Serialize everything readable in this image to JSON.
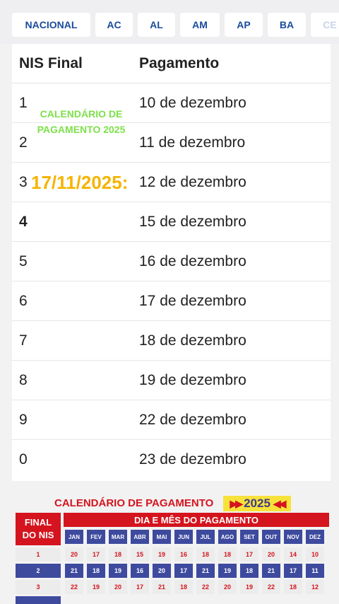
{
  "tabs": [
    "NACIONAL",
    "AC",
    "AL",
    "AM",
    "AP",
    "BA",
    "CE"
  ],
  "table": {
    "headers": {
      "nis": "NIS Final",
      "pagamento": "Pagamento"
    },
    "rows": [
      {
        "nis": "1",
        "pagamento": "10 de dezembro"
      },
      {
        "nis": "2",
        "pagamento": "11 de dezembro"
      },
      {
        "nis": "3",
        "pagamento": "12 de dezembro"
      },
      {
        "nis": "4",
        "pagamento": "15 de dezembro"
      },
      {
        "nis": "5",
        "pagamento": "16 de dezembro"
      },
      {
        "nis": "6",
        "pagamento": "17 de dezembro"
      },
      {
        "nis": "7",
        "pagamento": "18 de dezembro"
      },
      {
        "nis": "8",
        "pagamento": "19 de dezembro"
      },
      {
        "nis": "9",
        "pagamento": "22 de dezembro"
      },
      {
        "nis": "0",
        "pagamento": "23 de dezembro"
      }
    ]
  },
  "watermark": {
    "line1": "CALENDÁRIO DE",
    "line2": "PAGAMENTO 2025",
    "date": "17/11/2025:"
  },
  "calendar": {
    "title": "CALENDÁRIO DE PAGAMENTO",
    "year": "2025",
    "final_line1": "FINAL",
    "final_line2": "DO NIS",
    "header": "DIA E MÊS DO PAGAMENTO",
    "months": [
      "JAN",
      "FEV",
      "MAR",
      "ABR",
      "MAI",
      "JUN",
      "JUL",
      "AGO",
      "SET",
      "OUT",
      "NOV",
      "DEZ"
    ],
    "rows": [
      {
        "nis": "1",
        "days": [
          "20",
          "17",
          "18",
          "15",
          "19",
          "16",
          "18",
          "18",
          "17",
          "20",
          "14",
          "10"
        ]
      },
      {
        "nis": "2",
        "days": [
          "21",
          "18",
          "19",
          "16",
          "20",
          "17",
          "21",
          "19",
          "18",
          "21",
          "17",
          "11"
        ]
      },
      {
        "nis": "3",
        "days": [
          "22",
          "19",
          "20",
          "17",
          "21",
          "18",
          "22",
          "20",
          "19",
          "22",
          "18",
          "12"
        ]
      }
    ]
  }
}
